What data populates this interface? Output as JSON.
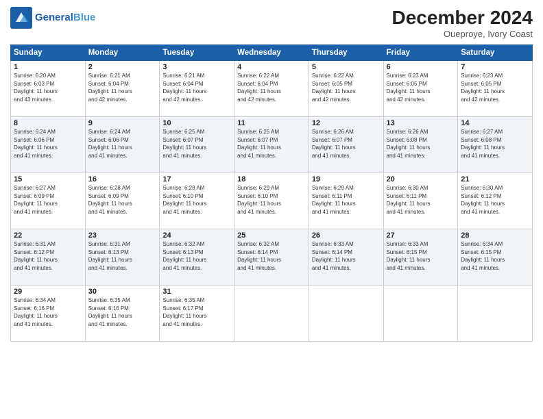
{
  "header": {
    "logo_line1": "General",
    "logo_line2": "Blue",
    "month": "December 2024",
    "location": "Oueproye, Ivory Coast"
  },
  "weekdays": [
    "Sunday",
    "Monday",
    "Tuesday",
    "Wednesday",
    "Thursday",
    "Friday",
    "Saturday"
  ],
  "weeks": [
    [
      {
        "day": "1",
        "info": "Sunrise: 6:20 AM\nSunset: 6:03 PM\nDaylight: 11 hours\nand 43 minutes."
      },
      {
        "day": "2",
        "info": "Sunrise: 6:21 AM\nSunset: 6:04 PM\nDaylight: 11 hours\nand 42 minutes."
      },
      {
        "day": "3",
        "info": "Sunrise: 6:21 AM\nSunset: 6:04 PM\nDaylight: 11 hours\nand 42 minutes."
      },
      {
        "day": "4",
        "info": "Sunrise: 6:22 AM\nSunset: 6:04 PM\nDaylight: 11 hours\nand 42 minutes."
      },
      {
        "day": "5",
        "info": "Sunrise: 6:22 AM\nSunset: 6:05 PM\nDaylight: 11 hours\nand 42 minutes."
      },
      {
        "day": "6",
        "info": "Sunrise: 6:23 AM\nSunset: 6:05 PM\nDaylight: 11 hours\nand 42 minutes."
      },
      {
        "day": "7",
        "info": "Sunrise: 6:23 AM\nSunset: 6:05 PM\nDaylight: 11 hours\nand 42 minutes."
      }
    ],
    [
      {
        "day": "8",
        "info": "Sunrise: 6:24 AM\nSunset: 6:06 PM\nDaylight: 11 hours\nand 41 minutes."
      },
      {
        "day": "9",
        "info": "Sunrise: 6:24 AM\nSunset: 6:06 PM\nDaylight: 11 hours\nand 41 minutes."
      },
      {
        "day": "10",
        "info": "Sunrise: 6:25 AM\nSunset: 6:07 PM\nDaylight: 11 hours\nand 41 minutes."
      },
      {
        "day": "11",
        "info": "Sunrise: 6:25 AM\nSunset: 6:07 PM\nDaylight: 11 hours\nand 41 minutes."
      },
      {
        "day": "12",
        "info": "Sunrise: 6:26 AM\nSunset: 6:07 PM\nDaylight: 11 hours\nand 41 minutes."
      },
      {
        "day": "13",
        "info": "Sunrise: 6:26 AM\nSunset: 6:08 PM\nDaylight: 11 hours\nand 41 minutes."
      },
      {
        "day": "14",
        "info": "Sunrise: 6:27 AM\nSunset: 6:08 PM\nDaylight: 11 hours\nand 41 minutes."
      }
    ],
    [
      {
        "day": "15",
        "info": "Sunrise: 6:27 AM\nSunset: 6:09 PM\nDaylight: 11 hours\nand 41 minutes."
      },
      {
        "day": "16",
        "info": "Sunrise: 6:28 AM\nSunset: 6:09 PM\nDaylight: 11 hours\nand 41 minutes."
      },
      {
        "day": "17",
        "info": "Sunrise: 6:28 AM\nSunset: 6:10 PM\nDaylight: 11 hours\nand 41 minutes."
      },
      {
        "day": "18",
        "info": "Sunrise: 6:29 AM\nSunset: 6:10 PM\nDaylight: 11 hours\nand 41 minutes."
      },
      {
        "day": "19",
        "info": "Sunrise: 6:29 AM\nSunset: 6:11 PM\nDaylight: 11 hours\nand 41 minutes."
      },
      {
        "day": "20",
        "info": "Sunrise: 6:30 AM\nSunset: 6:11 PM\nDaylight: 11 hours\nand 41 minutes."
      },
      {
        "day": "21",
        "info": "Sunrise: 6:30 AM\nSunset: 6:12 PM\nDaylight: 11 hours\nand 41 minutes."
      }
    ],
    [
      {
        "day": "22",
        "info": "Sunrise: 6:31 AM\nSunset: 6:12 PM\nDaylight: 11 hours\nand 41 minutes."
      },
      {
        "day": "23",
        "info": "Sunrise: 6:31 AM\nSunset: 6:13 PM\nDaylight: 11 hours\nand 41 minutes."
      },
      {
        "day": "24",
        "info": "Sunrise: 6:32 AM\nSunset: 6:13 PM\nDaylight: 11 hours\nand 41 minutes."
      },
      {
        "day": "25",
        "info": "Sunrise: 6:32 AM\nSunset: 6:14 PM\nDaylight: 11 hours\nand 41 minutes."
      },
      {
        "day": "26",
        "info": "Sunrise: 6:33 AM\nSunset: 6:14 PM\nDaylight: 11 hours\nand 41 minutes."
      },
      {
        "day": "27",
        "info": "Sunrise: 6:33 AM\nSunset: 6:15 PM\nDaylight: 11 hours\nand 41 minutes."
      },
      {
        "day": "28",
        "info": "Sunrise: 6:34 AM\nSunset: 6:15 PM\nDaylight: 11 hours\nand 41 minutes."
      }
    ],
    [
      {
        "day": "29",
        "info": "Sunrise: 6:34 AM\nSunset: 6:16 PM\nDaylight: 11 hours\nand 41 minutes."
      },
      {
        "day": "30",
        "info": "Sunrise: 6:35 AM\nSunset: 6:16 PM\nDaylight: 11 hours\nand 41 minutes."
      },
      {
        "day": "31",
        "info": "Sunrise: 6:35 AM\nSunset: 6:17 PM\nDaylight: 11 hours\nand 41 minutes."
      },
      null,
      null,
      null,
      null
    ]
  ]
}
